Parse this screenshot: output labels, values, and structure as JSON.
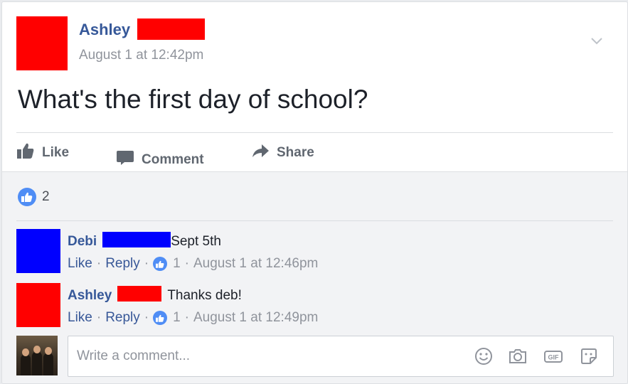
{
  "post": {
    "author": "Ashley",
    "timestamp": "August 1 at 12:42pm",
    "text": "What's the first day of school?",
    "options_icon": "chevron-down-icon"
  },
  "actions": {
    "like": "Like",
    "comment": "Comment",
    "share": "Share"
  },
  "reactions": {
    "count": "2"
  },
  "comments": [
    {
      "author": "Debi",
      "text": "Sept 5th",
      "like": "Like",
      "reply": "Reply",
      "likes": "1",
      "timestamp": "August 1 at 12:46pm",
      "avatar_color": "#0000ff"
    },
    {
      "author": "Ashley",
      "text": "Thanks deb!",
      "like": "Like",
      "reply": "Reply",
      "likes": "1",
      "timestamp": "August 1 at 12:49pm",
      "avatar_color": "#ff0000"
    }
  ],
  "composer": {
    "placeholder": "Write a comment...",
    "icons": [
      "emoji-icon",
      "camera-icon",
      "gif-icon",
      "sticker-icon"
    ],
    "gif_label": "GIF"
  },
  "colors": {
    "link_blue": "#365899",
    "like_blue": "#4f8df5",
    "redaction_red": "#ff0000",
    "redaction_blue": "#0000ff"
  }
}
